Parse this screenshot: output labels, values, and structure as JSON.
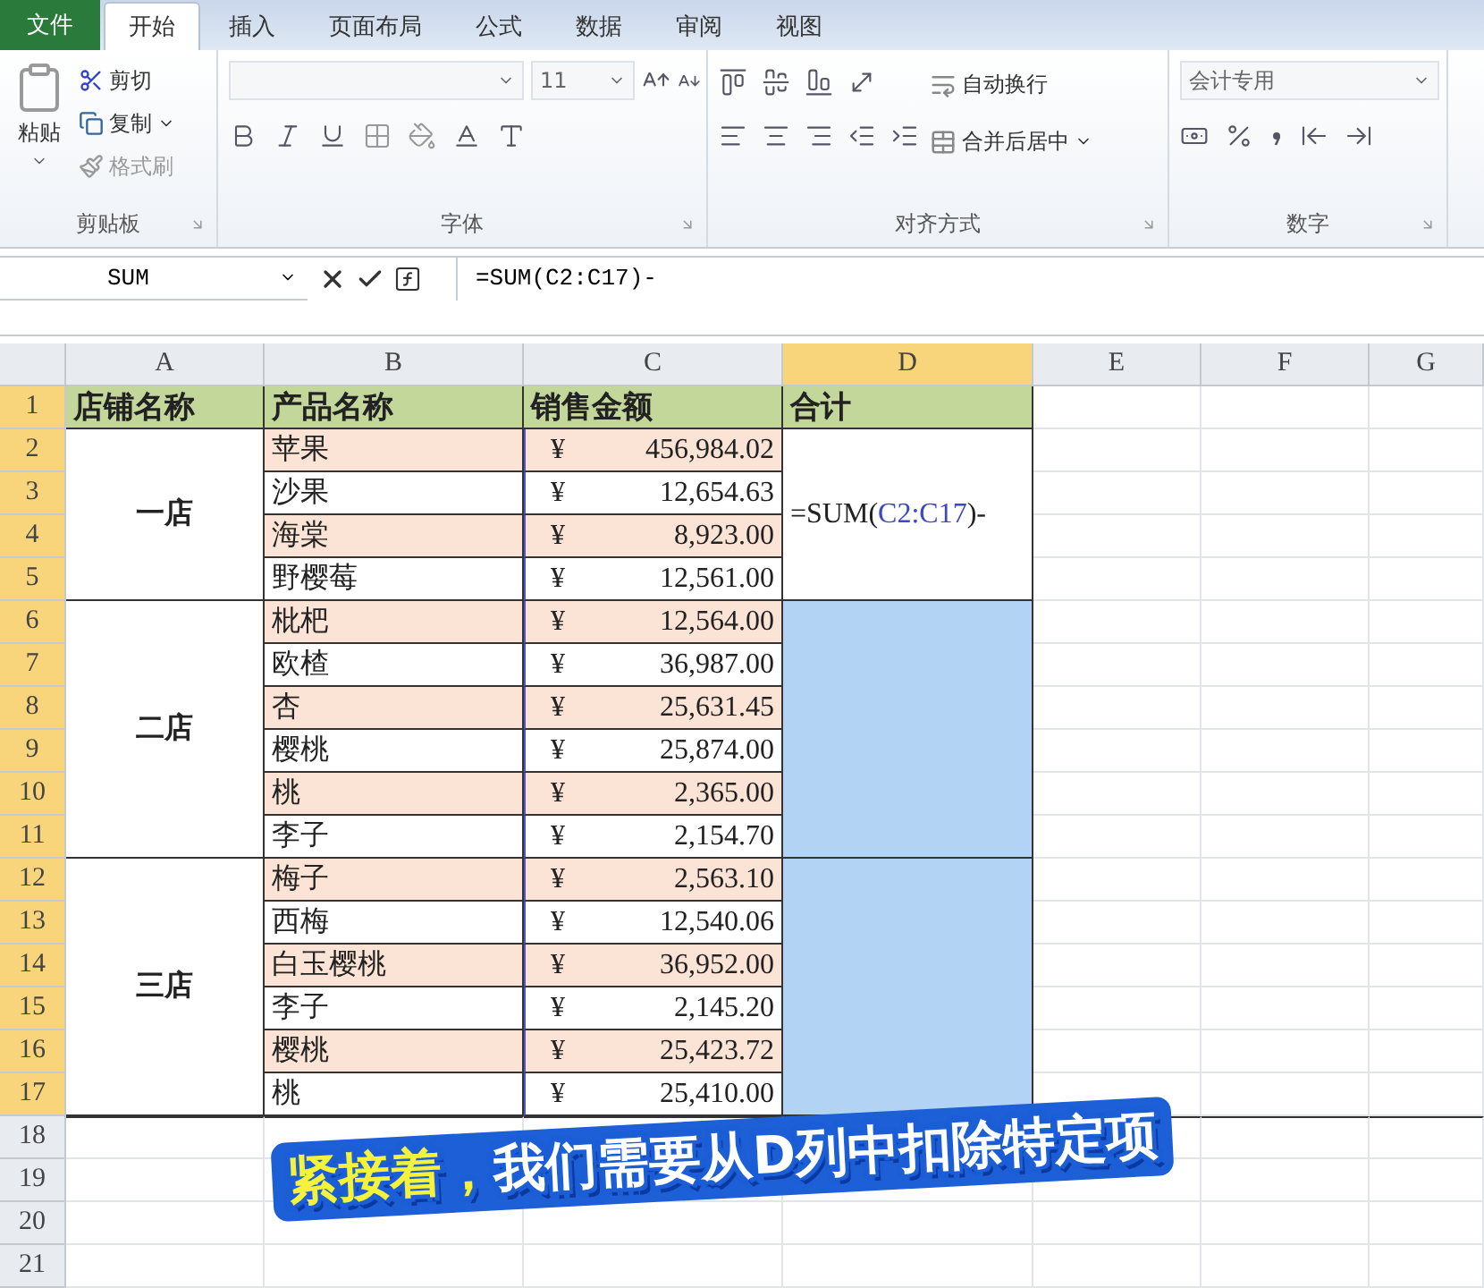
{
  "tabs": [
    {
      "label": "文件",
      "kind": "file",
      "selected": false
    },
    {
      "label": "开始",
      "kind": "tab",
      "selected": true
    },
    {
      "label": "插入",
      "kind": "tab",
      "selected": false
    },
    {
      "label": "页面布局",
      "kind": "tab",
      "selected": false
    },
    {
      "label": "公式",
      "kind": "tab",
      "selected": false
    },
    {
      "label": "数据",
      "kind": "tab",
      "selected": false
    },
    {
      "label": "审阅",
      "kind": "tab",
      "selected": false
    },
    {
      "label": "视图",
      "kind": "tab",
      "selected": false
    }
  ],
  "ribbon": {
    "clipboard": {
      "title": "剪贴板",
      "paste": "粘贴",
      "cut": "剪切",
      "copy": "复制",
      "format_painter": "格式刷",
      "format_painter_disabled": true
    },
    "font": {
      "title": "字体",
      "size": "11"
    },
    "alignment": {
      "title": "对齐方式",
      "wrap": "自动换行",
      "merge": "合并后居中"
    },
    "number": {
      "title": "数字",
      "format": "会计专用"
    }
  },
  "formula_bar": {
    "name_box": "SUM",
    "formula": "=SUM(C2:C17)-"
  },
  "column_headers": [
    {
      "label": "A",
      "selected": false
    },
    {
      "label": "B",
      "selected": false
    },
    {
      "label": "C",
      "selected": false
    },
    {
      "label": "D",
      "selected": true
    },
    {
      "label": "E",
      "selected": false
    },
    {
      "label": "F",
      "selected": false
    },
    {
      "label": "G",
      "selected": false
    }
  ],
  "row_headers": [
    {
      "label": "1",
      "selected": true
    },
    {
      "label": "2",
      "selected": true
    },
    {
      "label": "3",
      "selected": true
    },
    {
      "label": "4",
      "selected": true
    },
    {
      "label": "5",
      "selected": true
    },
    {
      "label": "6",
      "selected": true
    },
    {
      "label": "7",
      "selected": true
    },
    {
      "label": "8",
      "selected": true
    },
    {
      "label": "9",
      "selected": true
    },
    {
      "label": "10",
      "selected": true
    },
    {
      "label": "11",
      "selected": true
    },
    {
      "label": "12",
      "selected": true
    },
    {
      "label": "13",
      "selected": true
    },
    {
      "label": "14",
      "selected": true
    },
    {
      "label": "15",
      "selected": true
    },
    {
      "label": "16",
      "selected": true
    },
    {
      "label": "17",
      "selected": true
    },
    {
      "label": "18",
      "selected": false
    },
    {
      "label": "19",
      "selected": false
    },
    {
      "label": "20",
      "selected": false
    },
    {
      "label": "21",
      "selected": false
    }
  ],
  "header_row": [
    "店铺名称",
    "产品名称",
    "销售金额",
    "合计"
  ],
  "stores": [
    {
      "name": "一店",
      "total": {
        "selected": false,
        "formula": [
          {
            "text": "=SUM(",
            "kind": "plain"
          },
          {
            "text": "C2:C17",
            "kind": "ref"
          },
          {
            "text": ")-",
            "kind": "plain"
          }
        ]
      },
      "products": [
        {
          "name": "苹果",
          "currency": "¥",
          "amount": "456,984.02",
          "shaded": true
        },
        {
          "name": "沙果",
          "currency": "¥",
          "amount": "12,654.63",
          "shaded": false
        },
        {
          "name": "海棠",
          "currency": "¥",
          "amount": "8,923.00",
          "shaded": true
        },
        {
          "name": "野樱莓",
          "currency": "¥",
          "amount": "12,561.00",
          "shaded": false
        }
      ]
    },
    {
      "name": "二店",
      "total": {
        "selected": true
      },
      "products": [
        {
          "name": "枇杷",
          "currency": "¥",
          "amount": "12,564.00",
          "shaded": true
        },
        {
          "name": "欧楂",
          "currency": "¥",
          "amount": "36,987.00",
          "shaded": false
        },
        {
          "name": "杏",
          "currency": "¥",
          "amount": "25,631.45",
          "shaded": true
        },
        {
          "name": "樱桃",
          "currency": "¥",
          "amount": "25,874.00",
          "shaded": false
        },
        {
          "name": "桃",
          "currency": "¥",
          "amount": "2,365.00",
          "shaded": true
        },
        {
          "name": "李子",
          "currency": "¥",
          "amount": "2,154.70",
          "shaded": false
        }
      ]
    },
    {
      "name": "三店",
      "total": {
        "selected": true
      },
      "products": [
        {
          "name": "梅子",
          "currency": "¥",
          "amount": "2,563.10",
          "shaded": true
        },
        {
          "name": "西梅",
          "currency": "¥",
          "amount": "12,540.06",
          "shaded": false
        },
        {
          "name": "白玉樱桃",
          "currency": "¥",
          "amount": "36,952.00",
          "shaded": true
        },
        {
          "name": "李子",
          "currency": "¥",
          "amount": "2,145.20",
          "shaded": false
        },
        {
          "name": "樱桃",
          "currency": "¥",
          "amount": "25,423.72",
          "shaded": true
        },
        {
          "name": "桃",
          "currency": "¥",
          "amount": "25,410.00",
          "shaded": false
        }
      ]
    }
  ],
  "caption": [
    {
      "text": "紧接着，",
      "kind": "highlight"
    },
    {
      "text": "我们需要从D列中扣除特定项",
      "kind": "plain"
    }
  ]
}
